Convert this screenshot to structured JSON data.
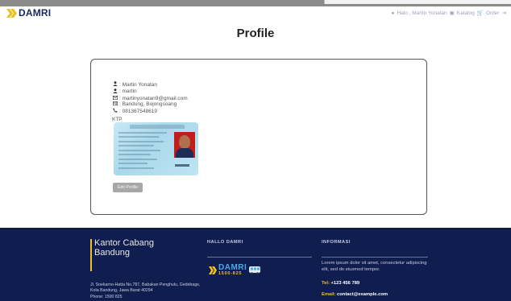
{
  "brand": {
    "name": "DAMRI"
  },
  "nav": {
    "greeting": "Halo , Martin Yonatan",
    "katalog": "Katalog",
    "order": "Order"
  },
  "page": {
    "title": "Profile"
  },
  "profile": {
    "full_name": ": Martin Yonatan",
    "username": ": martin",
    "email": ": martinyonatan9@gmail.com",
    "address": ": Bandung, Bojongsoang",
    "phone": ": 081367548619",
    "ktp_label": "KTP",
    "edit_label": "Edit Profile"
  },
  "footer": {
    "office_name": "Kantor Cabang Bandung",
    "office_address": "Jl. Soekarno-Hatta No.787, Babakan Penghulu, Gedebage, Kota Bandung, Jawa Barat 40294",
    "office_phone": "Phone: 1500 825",
    "hallo_heading": "HALLO DAMRI",
    "logo_text": "DAMRI",
    "logo_number": "1500-825",
    "info_heading": "INFORMASI",
    "info_text": "Lorem ipsum dolor sit amet, consectetur adipiscing elit, sed do eiusmod tempor.",
    "tel_label": "Tel:",
    "tel_value": "+123 456 789",
    "email_label": "Email:",
    "email_value": "contact@example.com"
  },
  "colors": {
    "navy": "#101d4f",
    "brand_blue": "#1c2a63",
    "accent_yellow": "#f0c020",
    "button_gray": "#a7a7a7"
  },
  "icons": [
    "user-icon",
    "envelope-icon",
    "address-card-icon",
    "phone-icon",
    "cart-icon",
    "logout-icon",
    "bus-icon"
  ]
}
